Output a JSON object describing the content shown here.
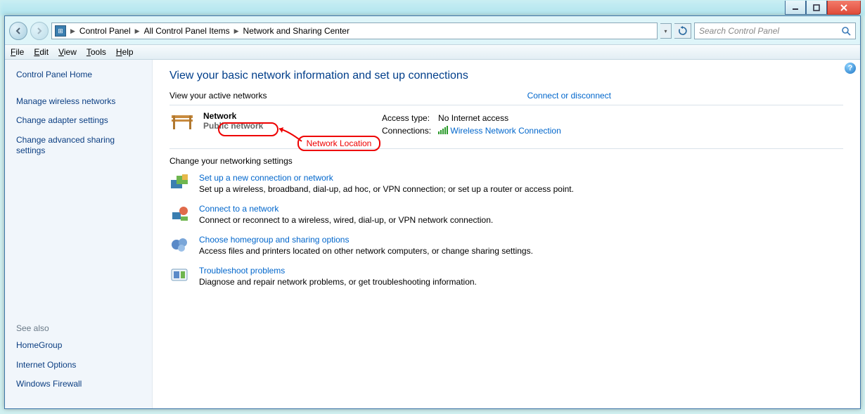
{
  "breadcrumb": {
    "items": [
      "Control Panel",
      "All Control Panel Items",
      "Network and Sharing Center"
    ]
  },
  "search": {
    "placeholder": "Search Control Panel"
  },
  "menu": {
    "file": "File",
    "edit": "Edit",
    "view": "View",
    "tools": "Tools",
    "help": "Help"
  },
  "sidebar": {
    "home": "Control Panel Home",
    "links": [
      "Manage wireless networks",
      "Change adapter settings",
      "Change advanced sharing settings"
    ],
    "seealso_hdr": "See also",
    "seealso": [
      "HomeGroup",
      "Internet Options",
      "Windows Firewall"
    ]
  },
  "main": {
    "title": "View your basic network information and set up connections",
    "active_hdr": "View your active networks",
    "connect_link": "Connect or disconnect",
    "network_name": "Network",
    "network_type": "Public network",
    "access_label": "Access type:",
    "access_value": "No Internet access",
    "conn_label": "Connections:",
    "conn_value": "Wireless Network Connection",
    "settings_hdr": "Change your networking settings",
    "tasks": [
      {
        "title": "Set up a new connection or network",
        "desc": "Set up a wireless, broadband, dial-up, ad hoc, or VPN connection; or set up a router or access point."
      },
      {
        "title": "Connect to a network",
        "desc": "Connect or reconnect to a wireless, wired, dial-up, or VPN network connection."
      },
      {
        "title": "Choose homegroup and sharing options",
        "desc": "Access files and printers located on other network computers, or change sharing settings."
      },
      {
        "title": "Troubleshoot problems",
        "desc": "Diagnose and repair network problems, or get troubleshooting information."
      }
    ]
  },
  "annotation": {
    "label": "Network Location"
  }
}
